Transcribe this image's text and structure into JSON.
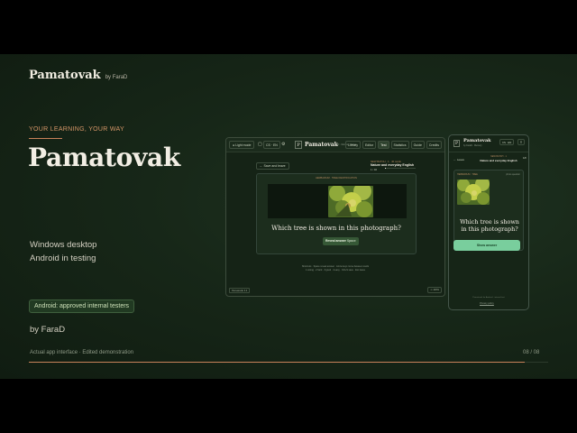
{
  "brand": {
    "name": "Pamatovak",
    "by": "by FaraD"
  },
  "hero": {
    "eyebrow": "YOUR LEARNING, YOUR WAY",
    "title": "Pamatovak",
    "platforms": [
      "Windows desktop",
      "Android in testing"
    ],
    "badge": "Android: approved internal testers",
    "author": "by FaraD"
  },
  "footer": {
    "note": "Actual app interface · Edited demonstration",
    "page": "08 / 08",
    "progress": 0.955
  },
  "desktop": {
    "light_mode": "Light mode",
    "lang": "CS · EN",
    "app_name": "Pamatovak",
    "app_subtitle": "by FaraD · Memory trainer",
    "tabs": [
      "Library",
      "Editor",
      "Test",
      "Statistics",
      "Guide",
      "Credits"
    ],
    "active_tab": "Test",
    "back_label": "← Save and leave",
    "status_line": "NEW BATCH · 1 · 40 cards",
    "deck_name": "Nature and everyday English",
    "card_count": "1 / 40",
    "session_progress": 0.03,
    "card_meta": "HERBARIUM · TREE IDENTIFICATION",
    "question": "Which tree is shown in this photograph?",
    "reveal_label": "Reveal answer",
    "reveal_key": "Space",
    "hint_1": "Shortcuts · Space reveal answer · Arrow keys move between cards",
    "hint_2": "1 wrong · 2 hard · 3 good · 4 easy · Ctrl+S save · Esc leave",
    "version": "Pamatovak 3.4",
    "zoom": "100%"
  },
  "phone": {
    "app_name": "Pamatovak",
    "app_subtitle": "by FaraD · Memory",
    "lang": "CS · EN",
    "menu": "≡",
    "back_label": "← Leave",
    "status_line": "NEW BATCH · 1",
    "deck_name": "Nature and everyday English",
    "count": "1/8",
    "meta_left": "HERBARIUM · TREE",
    "meta_right": "photo question",
    "question": "Which tree is shown in this photograph?",
    "show_label": "Show answer",
    "footer_text": "Pamatovak for Android · internal test",
    "privacy": "Privacy policy"
  },
  "colors": {
    "accent": "#c8825a",
    "background": "#172718",
    "phone_button": "#79ce9d",
    "desktop_button": "#365836"
  }
}
